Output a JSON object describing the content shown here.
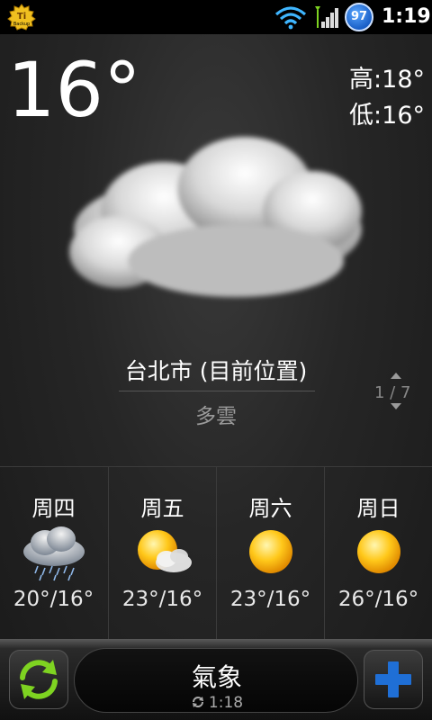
{
  "status_bar": {
    "app_icon": "titanium-backup-icon",
    "app_icon_text": "Backup",
    "battery_level": "97",
    "time": "1:19",
    "icons": [
      "wifi-icon",
      "signal-icon",
      "battery-icon"
    ]
  },
  "current": {
    "temperature": "16°",
    "high": "高:18°",
    "low": "低:16°",
    "icon": "cloudy-icon",
    "location": "台北市 (目前位置)",
    "condition": "多雲",
    "pager": "1 / 7"
  },
  "forecast": [
    {
      "day": "周四",
      "temp": "20°/16°",
      "icon": "rain-cloud-icon"
    },
    {
      "day": "周五",
      "temp": "23°/16°",
      "icon": "partly-cloudy-icon"
    },
    {
      "day": "周六",
      "temp": "23°/16°",
      "icon": "sunny-icon"
    },
    {
      "day": "周日",
      "temp": "26°/16°",
      "icon": "sunny-icon"
    }
  ],
  "bottom_bar": {
    "title": "氣象",
    "updated_time": "1:18"
  },
  "colors": {
    "accent_green": "#7ed321",
    "accent_blue": "#1f6fd6"
  }
}
